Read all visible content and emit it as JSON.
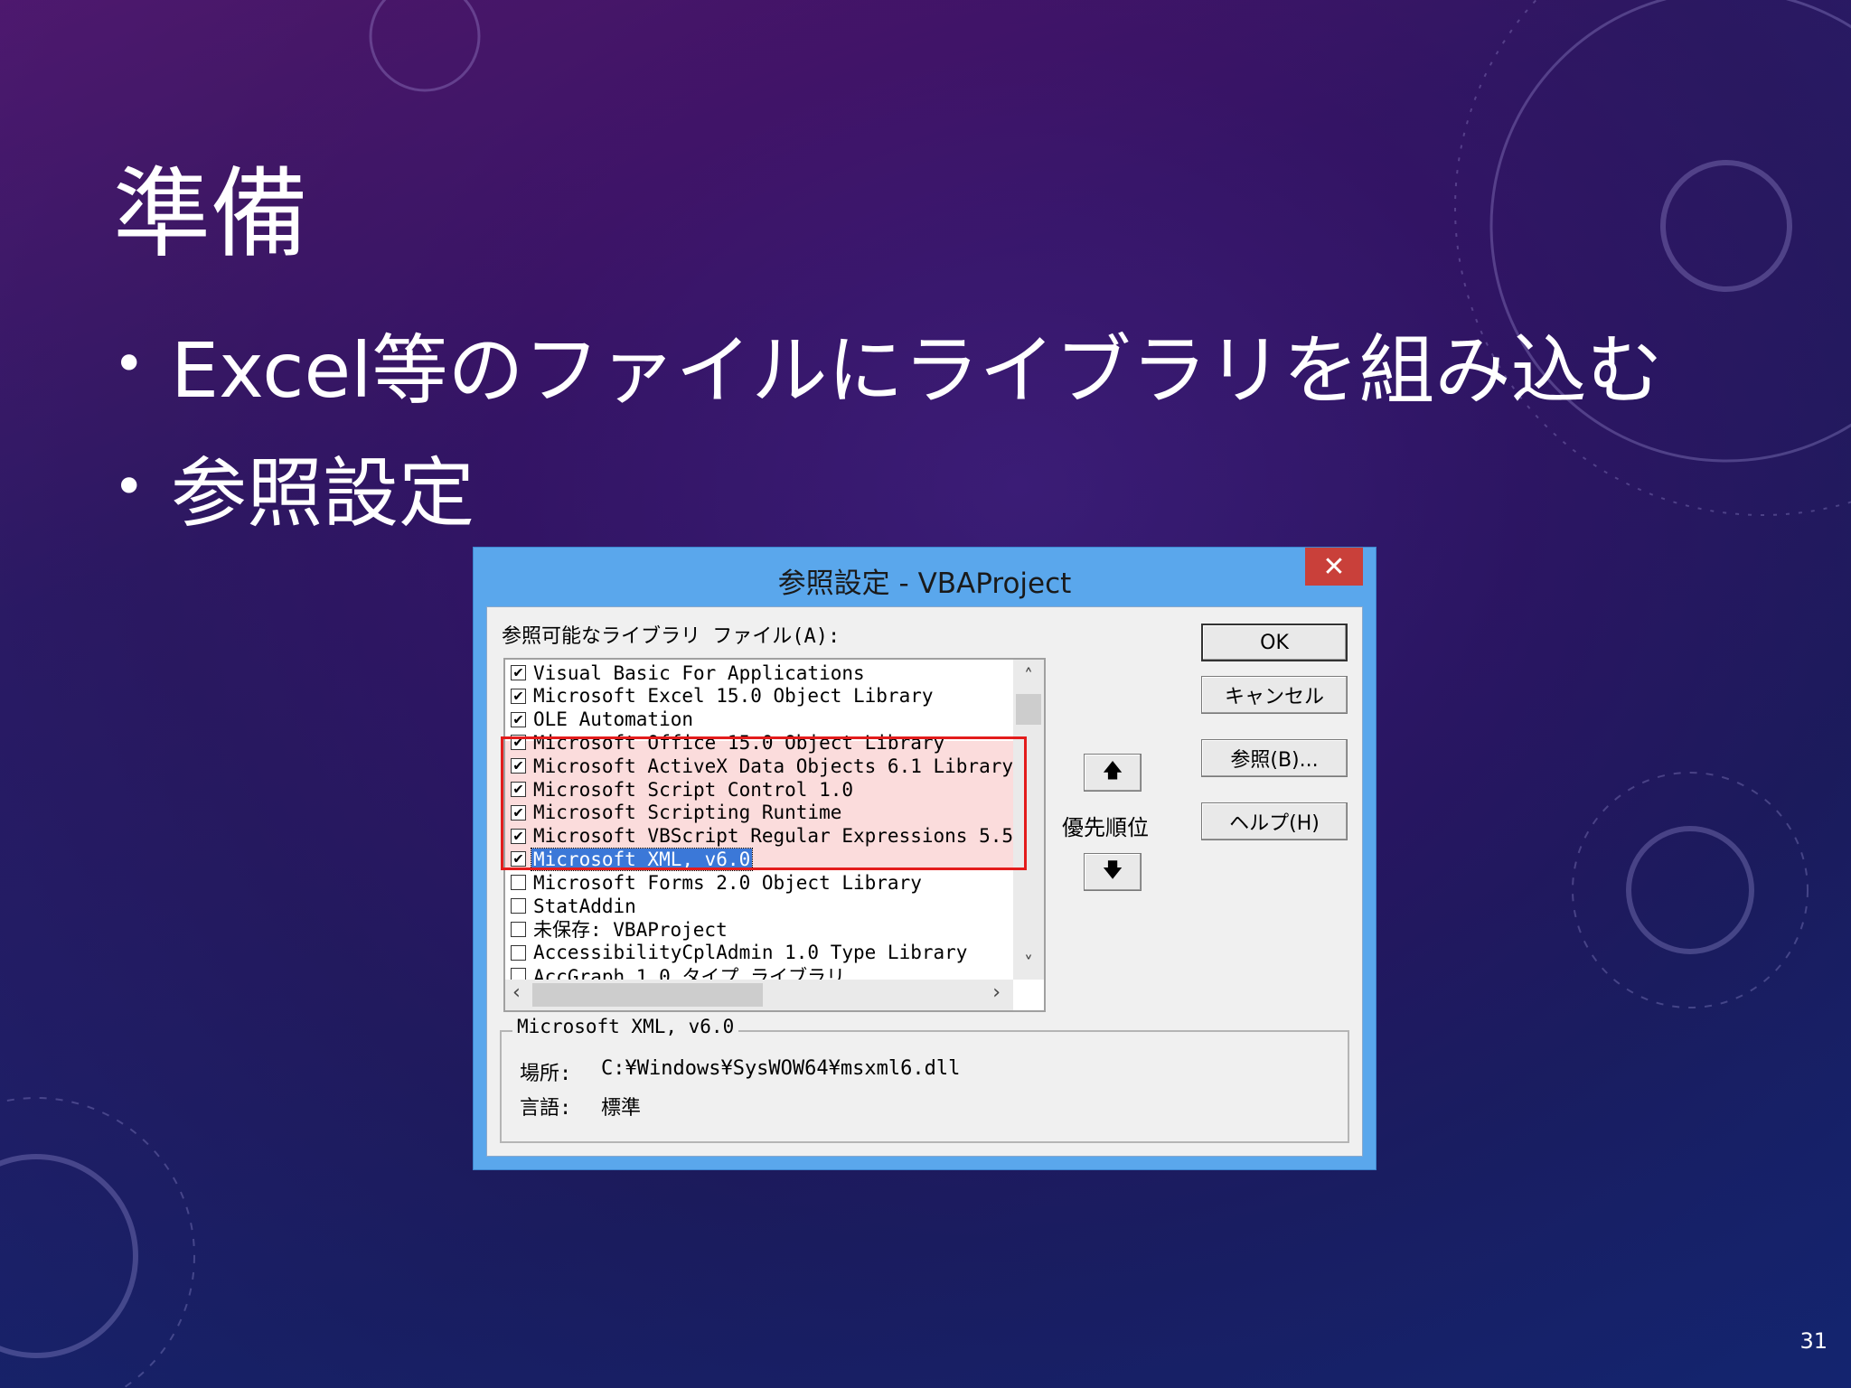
{
  "slide": {
    "title": "準備",
    "bullets": [
      "Excel等のファイルにライブラリを組み込む",
      "参照設定"
    ],
    "page_number": "31"
  },
  "dialog": {
    "title": "参照設定 - VBAProject",
    "close_glyph": "✕",
    "available_label": "参照可能なライブラリ ファイル(A):",
    "items": [
      {
        "label": "Visual Basic For Applications",
        "checked": true
      },
      {
        "label": "Microsoft Excel 15.0 Object Library",
        "checked": true
      },
      {
        "label": "OLE Automation",
        "checked": true
      },
      {
        "label": "Microsoft Office 15.0 Object Library",
        "checked": true
      },
      {
        "label": "Microsoft ActiveX Data Objects 6.1 Library",
        "checked": true
      },
      {
        "label": "Microsoft Script Control 1.0",
        "checked": true
      },
      {
        "label": "Microsoft Scripting Runtime",
        "checked": true
      },
      {
        "label": "Microsoft VBScript Regular Expressions 5.5",
        "checked": true
      },
      {
        "label": "Microsoft XML, v6.0",
        "checked": true,
        "selected": true
      },
      {
        "label": "Microsoft Forms 2.0 Object Library",
        "checked": false
      },
      {
        "label": "StatAddin",
        "checked": false
      },
      {
        "label": "未保存: VBAProject",
        "checked": false
      },
      {
        "label": "AccessibilityCplAdmin 1.0 Type Library",
        "checked": false
      },
      {
        "label": "AccGraph 1.0 タイプ ライブラリ",
        "checked": false
      }
    ],
    "buttons": {
      "ok": "OK",
      "cancel": "キャンセル",
      "browse": "参照(B)...",
      "help": "ヘルプ(H)"
    },
    "priority_label": "優先順位",
    "priority_up": "🡅",
    "priority_down": "🡇",
    "details": {
      "legend": "Microsoft XML, v6.0",
      "location_key": "場所:",
      "location_value": "C:¥Windows¥SysWOW64¥msxml6.dll",
      "language_key": "言語:",
      "language_value": "標準"
    }
  }
}
